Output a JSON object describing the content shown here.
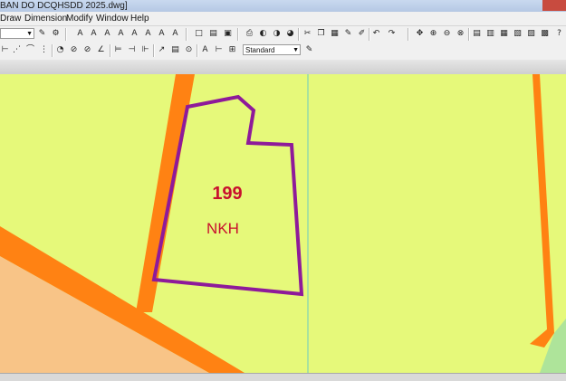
{
  "window": {
    "title": "BAN DO DCQHSDD 2025.dwg]"
  },
  "menu": {
    "items": [
      "Draw",
      "Dimension",
      "Modify",
      "Window",
      "Help"
    ]
  },
  "toolbar": {
    "text_style": "Standard"
  },
  "drawing": {
    "parcel_number": "199",
    "land_use_code": "NKH",
    "colors": {
      "background": "#e6f97a",
      "parcel_boundary": "#8e1a9a",
      "road": "#ff8213",
      "residential": "#f8c487",
      "grid_line": "#7fd3b5",
      "label": "#c8102e"
    }
  }
}
